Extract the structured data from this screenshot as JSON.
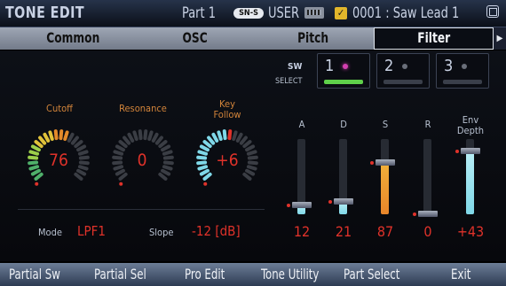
{
  "header": {
    "title": "TONE EDIT",
    "part": "Part 1",
    "engine_badge": "SN-S",
    "bank": "USER",
    "favorite_mark": "✓",
    "patch": "0001 : Saw Lead 1"
  },
  "tabs": [
    {
      "label": "Common",
      "active": false
    },
    {
      "label": "OSC",
      "active": false
    },
    {
      "label": "Pitch",
      "active": false
    },
    {
      "label": "Filter",
      "active": true
    }
  ],
  "tab_arrow": "▶",
  "partial_switch": {
    "sw_label": "SW",
    "select_label": "SELECT",
    "buttons": [
      {
        "number": "1",
        "selected": true
      },
      {
        "number": "2",
        "selected": false
      },
      {
        "number": "3",
        "selected": false
      }
    ]
  },
  "knobs": [
    {
      "label": "Cutoff",
      "value": "76",
      "level": 0.6
    },
    {
      "label": "Resonance",
      "value": "0",
      "level": 0.0
    },
    {
      "label": "Key\nFollow",
      "value": "+6",
      "level": 0.55
    }
  ],
  "filter": {
    "mode_label": "Mode",
    "mode_value": "LPF1",
    "slope_label": "Slope",
    "slope_value": "-12 [dB]"
  },
  "envelope": [
    {
      "label": "A",
      "value": "12",
      "level": 0.12
    },
    {
      "label": "D",
      "value": "21",
      "level": 0.17
    },
    {
      "label": "S",
      "value": "87",
      "level": 0.68
    },
    {
      "label": "R",
      "value": "0",
      "level": 0.0
    },
    {
      "label": "Env\nDepth",
      "value": "+43",
      "level": 0.83
    }
  ],
  "footer": [
    "Partial Sw",
    "Partial Sel",
    "Pro Edit",
    "Tone Utility",
    "Part Select",
    "Exit"
  ],
  "colors": {
    "value_red": "#e0322a",
    "label_orange": "#d2843a",
    "select_green": "#5fd04a",
    "sustain_orange": "#e8862a",
    "slider_cyan": "#7fd8e8"
  }
}
